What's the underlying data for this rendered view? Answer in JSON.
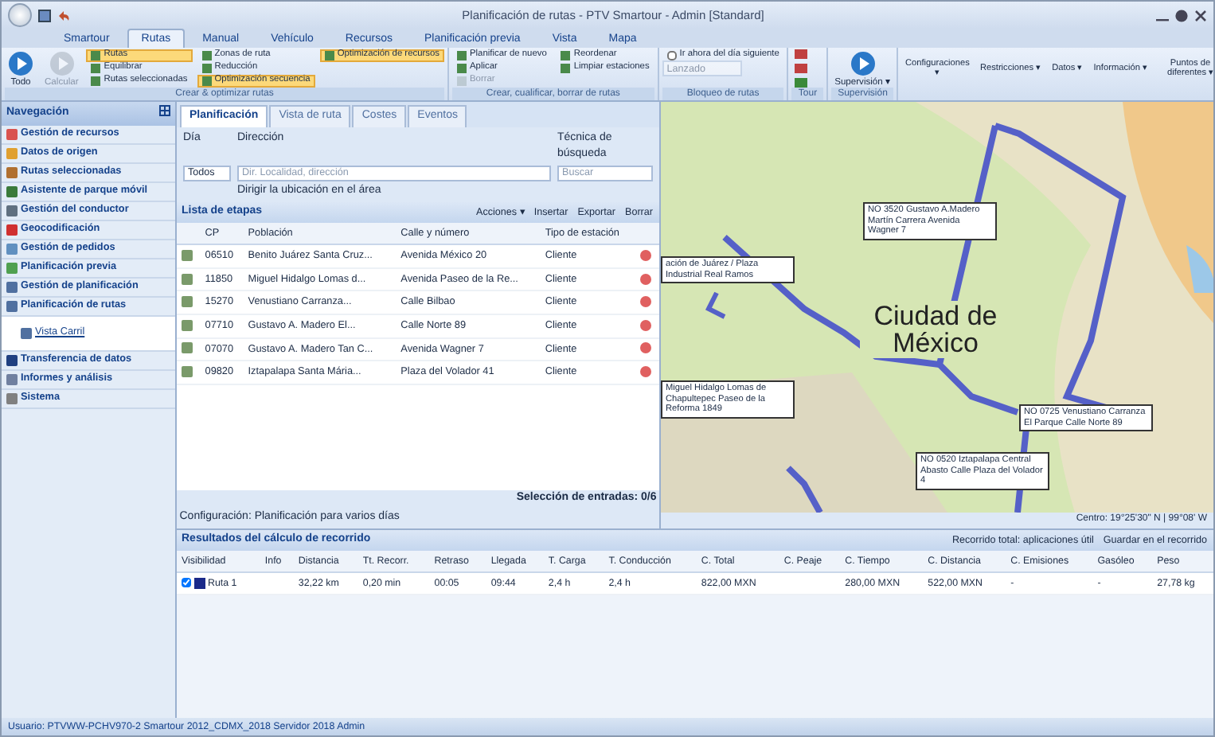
{
  "window": {
    "title": "Planificación de rutas - PTV Smartour - Admin [Standard]"
  },
  "ribbon_tabs": [
    {
      "label": "Smartour",
      "selected": false
    },
    {
      "label": "Rutas",
      "selected": true
    },
    {
      "label": "Manual",
      "selected": false
    },
    {
      "label": "Vehículo",
      "selected": false
    },
    {
      "label": "Recursos",
      "selected": false
    },
    {
      "label": "Planificación previa",
      "selected": false
    },
    {
      "label": "Vista",
      "selected": false
    },
    {
      "label": "Mapa",
      "selected": false
    }
  ],
  "ribbon_groups": [
    {
      "label": "Crear & optimizar rutas",
      "items": [
        {
          "kind": "large",
          "label": "Todo",
          "pressed": false,
          "disabled": false
        },
        {
          "kind": "large",
          "label": "Calcular",
          "pressed": false,
          "disabled": true
        },
        {
          "kind": "small",
          "label": "Rutas",
          "pressed": true,
          "disabled": false
        },
        {
          "kind": "small",
          "label": "Equilibrar",
          "pressed": false,
          "disabled": false
        },
        {
          "kind": "small",
          "label": "Rutas seleccionadas",
          "pressed": false,
          "disabled": false
        },
        {
          "kind": "small",
          "label": "Zonas de ruta",
          "pressed": false,
          "disabled": false
        },
        {
          "kind": "small",
          "label": "Reducción",
          "pressed": false,
          "disabled": false
        },
        {
          "kind": "small",
          "label": "Optimización secuencia",
          "pressed": true,
          "disabled": false
        },
        {
          "kind": "small",
          "label": "Optimización de recursos",
          "pressed": true,
          "disabled": false
        }
      ]
    },
    {
      "label": "Crear, cualificar, borrar de rutas",
      "items": [
        {
          "kind": "small",
          "label": "Planificar de nuevo",
          "pressed": false,
          "disabled": false
        },
        {
          "kind": "small",
          "label": "Aplicar",
          "pressed": false,
          "disabled": false
        },
        {
          "kind": "small",
          "label": "Borrar",
          "pressed": false,
          "disabled": true
        },
        {
          "kind": "small",
          "label": "Reordenar",
          "pressed": false,
          "disabled": false
        },
        {
          "kind": "small",
          "label": "Limpiar estaciones",
          "pressed": false,
          "disabled": false
        }
      ]
    },
    {
      "label": "Bloqueo de rutas",
      "items": [
        {
          "kind": "check",
          "label": "Ir ahora del día siguiente",
          "pressed": false,
          "disabled": false
        },
        {
          "kind": "field",
          "label": "Lanzado",
          "pressed": false,
          "disabled": true
        }
      ]
    },
    {
      "label": "Tour",
      "items": [
        {
          "kind": "stack",
          "pressed": false,
          "disabled": false
        }
      ]
    },
    {
      "label": "Supervisión",
      "items": [
        {
          "kind": "large",
          "label": "Supervisión ▾",
          "pressed": false,
          "disabled": false
        }
      ]
    },
    {
      "items": [
        {
          "kind": "text",
          "label": "Configuraciones ▾",
          "pressed": false,
          "disabled": false
        },
        {
          "kind": "text",
          "label": "Restricciones ▾",
          "pressed": false,
          "disabled": false
        },
        {
          "kind": "text",
          "label": "Datos ▾",
          "pressed": false,
          "disabled": false
        },
        {
          "kind": "text",
          "label": "Información ▾",
          "pressed": false,
          "disabled": false
        },
        {
          "kind": "text",
          "label": "Puntos de diferentes ▾",
          "pressed": false,
          "disabled": false
        }
      ]
    }
  ],
  "navigation": {
    "title": "Navegación",
    "items": [
      {
        "label": "Gestión de recursos",
        "color": "#d9534f",
        "selected": false
      },
      {
        "label": "Datos de origen",
        "color": "#e0a030",
        "selected": false
      },
      {
        "label": "Rutas seleccionadas",
        "color": "#b07030",
        "selected": false
      },
      {
        "label": "Asistente de parque móvil",
        "color": "#3a7a3a",
        "selected": false
      },
      {
        "label": "Gestión del conductor",
        "color": "#607080",
        "selected": false
      },
      {
        "label": "Geocodificación",
        "color": "#d03030",
        "selected": false
      },
      {
        "label": "Gestión de pedidos",
        "color": "#6090c0",
        "selected": false
      },
      {
        "label": "Planificación previa",
        "color": "#50a050",
        "selected": false
      },
      {
        "label": "Gestión de planificación",
        "color": "#5070a0",
        "selected": false
      },
      {
        "label": "Planificación de rutas",
        "color": "#5070a0",
        "selected": false,
        "children": [
          {
            "label": "Vista Carril",
            "color": "#5070a0",
            "selected": true
          }
        ]
      },
      {
        "label": "Transferencia de datos",
        "color": "#204080",
        "selected": false
      },
      {
        "label": "Informes y análisis",
        "color": "#7080a0",
        "selected": false
      },
      {
        "label": "Sistema",
        "color": "#808080",
        "selected": false
      }
    ]
  },
  "panel_tabs": [
    {
      "label": "Planificación",
      "selected": true
    },
    {
      "label": "Vista de ruta",
      "selected": false
    },
    {
      "label": "Costes",
      "selected": false
    },
    {
      "label": "Eventos",
      "selected": false
    }
  ],
  "filter": {
    "day_label": "Día",
    "day_value": "Todos",
    "address_label": "Dirección",
    "address_placeholder": "Dir. Localidad, dirección",
    "search_label": "Técnica de búsqueda",
    "search_placeholder": "Buscar",
    "hint": "Dirigir la ubicación en el área"
  },
  "stops": {
    "title": "Lista de etapas",
    "actions": [
      "Acciones ▾",
      "Insertar",
      "Exportar",
      "Borrar"
    ],
    "columns": [
      "CP",
      "Población",
      "Calle y número",
      "Tipo de estación"
    ],
    "rows": [
      {
        "cp": "06510",
        "poblacion": "Benito Juárez Santa Cruz...",
        "calle": "Avenida México 20",
        "tipo": "Cliente"
      },
      {
        "cp": "11850",
        "poblacion": "Miguel Hidalgo Lomas d...",
        "calle": "Avenida Paseo de la Re...",
        "tipo": "Cliente"
      },
      {
        "cp": "15270",
        "poblacion": "Venustiano Carranza...",
        "calle": "Calle Bilbao",
        "tipo": "Cliente"
      },
      {
        "cp": "07710",
        "poblacion": "Gustavo A. Madero El...",
        "calle": "Calle Norte 89",
        "tipo": "Cliente"
      },
      {
        "cp": "07070",
        "poblacion": "Gustavo A. Madero Tan C...",
        "calle": "Avenida Wagner 7",
        "tipo": "Cliente"
      },
      {
        "cp": "09820",
        "poblacion": "Iztapalapa Santa Mária...",
        "calle": "Plaza del Volador 41",
        "tipo": "Cliente"
      }
    ],
    "selection": "Selección de entradas: 0/6",
    "config": "Configuración: Planificación para varios días"
  },
  "map": {
    "city": "Ciudad de México",
    "callouts": [
      "NO 3520 Gustavo A.Madero Martín Carrera Avenida Wagner 7",
      "ación de Juárez / Plaza Industrial Real Ramos",
      "Miguel Hidalgo Lomas de Chapultepec Paseo de la Reforma 1849",
      "NO 0725 Venustiano Carranza El Parque Calle Norte 89",
      "NO 0520 Iztapalapa Central Abasto Calle Plaza del Volador 4"
    ],
    "status": "Centro: 19°25'30\" N | 99°08' W"
  },
  "results": {
    "title": "Resultados del cálculo de recorrido",
    "actions": [
      "Recorrido total: aplicaciones útil",
      "Guardar en el recorrido"
    ],
    "columns": [
      "Visibilidad",
      "Info",
      "Distancia",
      "Tt. Recorr.",
      "Retraso",
      "Llegada",
      "T. Carga",
      "T. Conducción",
      "C. Total",
      "C. Peaje",
      "C. Tiempo",
      "C. Distancia",
      "C. Emisiones",
      "Gasóleo",
      "Peso"
    ],
    "rows": [
      {
        "visible": true,
        "color": "#1a2a8a",
        "cells": [
          "Ruta 1",
          "",
          "32,22 km",
          "0,20 min",
          "00:05",
          "09:44",
          "2,4 h",
          "2,4 h",
          "822,00 MXN",
          "",
          "280,00 MXN",
          "522,00 MXN",
          "-",
          "-",
          "27,78 kg"
        ]
      }
    ]
  },
  "status_bar": "Usuario: PTVWW-PCHV970-2   Smartour 2012_CDMX_2018   Servidor 2018   Admin"
}
